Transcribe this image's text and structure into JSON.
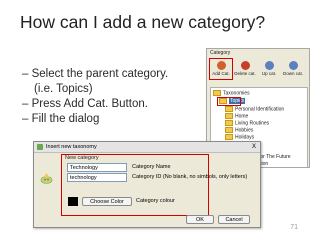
{
  "slide": {
    "title": "How can I add a new category?",
    "bullets": [
      "– Select the parent category.",
      "(i.e. Topics)",
      "– Press Add Cat. Button.",
      "– Fill the dialog"
    ],
    "page_number": "71"
  },
  "category_panel": {
    "label": "Category",
    "toolbar": {
      "add": "Add Cat.",
      "delete": "Delete cat.",
      "up": "Up cat.",
      "down": "Down cat."
    },
    "tree": {
      "root": "Taxonomies",
      "selected": "Topics",
      "items": [
        "Personal Identification",
        "Home",
        "Living Routines",
        "Hobbies",
        "Holidays"
      ],
      "partial": [
        "for The Future",
        "sion"
      ]
    }
  },
  "dialog": {
    "title": "Insert new taxonomy",
    "close": "X",
    "group_label": "New category",
    "name_value": "Technology",
    "name_label": "Category Name",
    "id_value": "technology",
    "id_label": "Category ID (No blank, no simbols, only letters)",
    "choose_color": "Choose Color",
    "colour_label": "Category colour",
    "ok": "OK",
    "cancel": "Cancel",
    "colors": {
      "highlight": "#d40000",
      "swatch": "#000000"
    }
  }
}
